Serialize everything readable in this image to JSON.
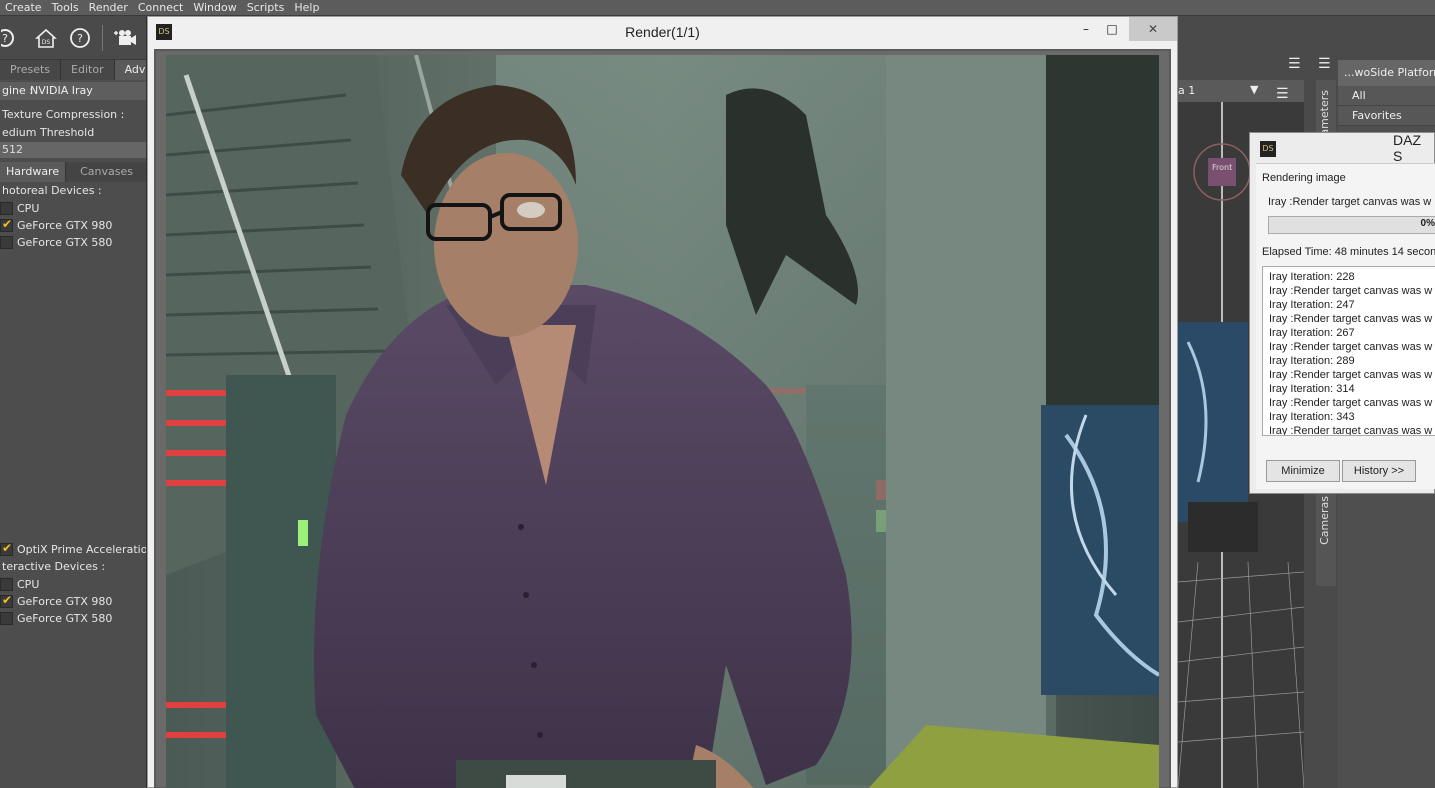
{
  "menu": [
    "Create",
    "Tools",
    "Render",
    "Connect",
    "Window",
    "Scripts",
    "Help"
  ],
  "left": {
    "tabs": [
      "Presets",
      "Editor",
      "Advan"
    ],
    "engine_label": "gine :",
    "engine_value": "NVIDIA Iray",
    "texture_compression": "Texture Compression :",
    "medium_threshold": "edium Threshold",
    "threshold_value": "512",
    "hw_tabs": [
      "Hardware",
      "Canvases"
    ],
    "photoreal_header": "hotoreal Devices :",
    "photoreal_devices": [
      {
        "name": "CPU",
        "checked": false
      },
      {
        "name": "GeForce GTX 980",
        "checked": true
      },
      {
        "name": "GeForce GTX 580",
        "checked": false
      }
    ],
    "optix_label": "OptiX Prime Acceleration",
    "interactive_header": "teractive Devices :",
    "interactive_devices": [
      {
        "name": "CPU",
        "checked": false
      },
      {
        "name": "GeForce GTX 980",
        "checked": true
      },
      {
        "name": "GeForce GTX 580",
        "checked": false
      }
    ]
  },
  "render_window": {
    "title": "Render(1/1)",
    "logo": "DS",
    "minimize": "–",
    "maximize": "□",
    "close": "✕"
  },
  "right": {
    "content_title": "...woSide Platform",
    "content_items": [
      "All",
      "Favorites"
    ],
    "viewport_camera": "a 1",
    "front_label": "Front",
    "parameters_tab": "Parameters",
    "cameras_tab": "Cameras"
  },
  "dialog": {
    "title": "DAZ S",
    "logo": "DS",
    "rendering_image": "Rendering image",
    "status": "Iray :Render target canvas was w",
    "progress": "0%",
    "elapsed": "Elapsed Time:  48 minutes 14 secon",
    "log": [
      "Iray Iteration: 228",
      "Iray :Render target canvas was w",
      "Iray Iteration: 247",
      "Iray :Render target canvas was w",
      "Iray Iteration: 267",
      "Iray :Render target canvas was w",
      "Iray Iteration: 289",
      "Iray :Render target canvas was w",
      "Iray Iteration: 314",
      "Iray :Render target canvas was w",
      "Iray Iteration: 343",
      "Iray :Render target canvas was w"
    ],
    "minimize_btn": "Minimize",
    "history_btn": "History >>"
  },
  "colors": {
    "checkmark": "#f0c020",
    "close_hover": "#c9c9c9"
  }
}
